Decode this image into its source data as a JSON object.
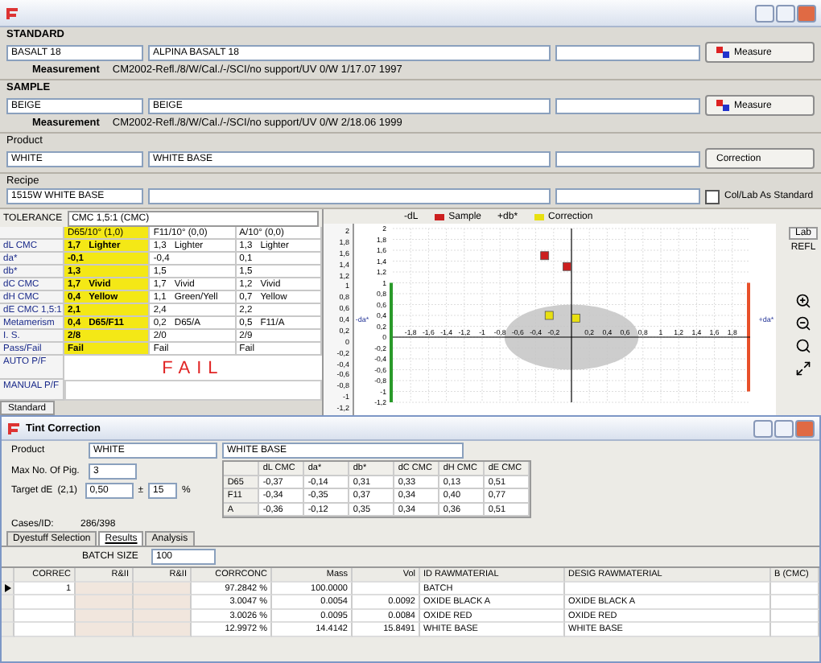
{
  "standard": {
    "label": "STANDARD",
    "code": "BASALT 18",
    "name": "ALPINA BASALT 18",
    "measure_button": "Measure",
    "measurement_label": "Measurement",
    "measurement": "CM2002-Refl./8/W/Cal./-/SCI/no support/UV 0/W 1/17.07 1997"
  },
  "sample": {
    "label": "SAMPLE",
    "code": "BEIGE",
    "name": "BEIGE",
    "measure_button": "Measure",
    "measurement_label": "Measurement",
    "measurement": "CM2002-Refl./8/W/Cal./-/SCI/no support/UV 0/W 2/18.06 1999"
  },
  "product": {
    "label": "Product",
    "code": "WHITE",
    "name": "WHITE BASE",
    "button": "Correction"
  },
  "recipe": {
    "label": "Recipe",
    "code": "1515W WHITE BASE",
    "checkbox": {
      "label": "Col/Lab As Standard",
      "checked": false
    }
  },
  "tolerance": {
    "label": "TOLERANCE",
    "value": "CMC 1,5:1 (CMC)"
  },
  "results_table": {
    "columns": [
      {
        "label": "D65/10° (1,0)",
        "highlighted": true
      },
      {
        "label": "F11/10° (0,0)",
        "highlighted": false
      },
      {
        "label": "A/10° (0,0)",
        "highlighted": false
      }
    ],
    "rows": [
      {
        "label": "dL CMC",
        "cells": [
          {
            "value": "1,7",
            "note": "Lighter"
          },
          {
            "value": "1,3",
            "note": "Lighter"
          },
          {
            "value": "1,3",
            "note": "Lighter"
          }
        ]
      },
      {
        "label": "da*",
        "cells": [
          {
            "value": "-0,1"
          },
          {
            "value": "-0,4"
          },
          {
            "value": "0,1"
          }
        ]
      },
      {
        "label": "db*",
        "cells": [
          {
            "value": "1,3"
          },
          {
            "value": "1,5"
          },
          {
            "value": "1,5"
          }
        ]
      },
      {
        "label": "dC CMC",
        "cells": [
          {
            "value": "1,7",
            "note": "Vivid"
          },
          {
            "value": "1,7",
            "note": "Vivid"
          },
          {
            "value": "1,2",
            "note": "Vivid"
          }
        ]
      },
      {
        "label": "dH CMC",
        "cells": [
          {
            "value": "0,4",
            "note": "Yellow"
          },
          {
            "value": "1,1",
            "note": "Green/Yell"
          },
          {
            "value": "0,7",
            "note": "Yellow"
          }
        ]
      },
      {
        "label": "dE CMC 1,5:1",
        "cells": [
          {
            "value": "2,1"
          },
          {
            "value": "2,4"
          },
          {
            "value": "2,2"
          }
        ]
      },
      {
        "label": "Metamerism",
        "cells": [
          {
            "value": "0,4",
            "note": "D65/F11"
          },
          {
            "value": "0,2",
            "note": "D65/A"
          },
          {
            "value": "0,5",
            "note": "F11/A"
          }
        ]
      },
      {
        "label": "I. S.",
        "cells": [
          {
            "value": "2/8"
          },
          {
            "value": "2/0"
          },
          {
            "value": "2/9"
          }
        ]
      },
      {
        "label": "Pass/Fail",
        "cells": [
          {
            "value": "Fail"
          },
          {
            "value": "Fail"
          },
          {
            "value": "Fail"
          }
        ]
      }
    ],
    "auto_label": "AUTO P/F",
    "verdict": "FAIL",
    "manual_label": "MANUAL P/F",
    "tab": "Standard"
  },
  "chart": {
    "top_label": "+db*",
    "left_label": "-da*",
    "right_label": "+da*",
    "l_label": "-dL",
    "l_ticks": [
      "2",
      "1,8",
      "1,6",
      "1,4",
      "1,2",
      "1",
      "0,8",
      "0,6",
      "0,4",
      "0,2",
      "0",
      "-0,2",
      "-0,4",
      "-0,6",
      "-0,8",
      "-1",
      "-1,2"
    ],
    "side_button": "Lab",
    "side_label": "REFL",
    "chart_data": {
      "type": "scatter",
      "grid": true,
      "x": [
        -0.3,
        -0.05,
        -0.25,
        0.05
      ],
      "xlim": [
        -2,
        2
      ],
      "ylim": [
        -1.2,
        2
      ],
      "xticks": [
        {
          "value": -1.8,
          "label": "-1,8"
        },
        {
          "value": -1.6,
          "label": "-1,6"
        },
        {
          "value": -1.4,
          "label": "-1,4"
        },
        {
          "value": -1.2,
          "label": "-1,2"
        },
        {
          "value": -1,
          "label": "-1"
        },
        {
          "value": -0.8,
          "label": "-0,8"
        },
        {
          "value": -0.6,
          "label": "-0,6"
        },
        {
          "value": -0.4,
          "label": "-0,4"
        },
        {
          "value": -0.2,
          "label": "-0,2"
        },
        {
          "value": 0.2,
          "label": "0,2"
        },
        {
          "value": 0.4,
          "label": "0,4"
        },
        {
          "value": 0.6,
          "label": "0,6"
        },
        {
          "value": 0.8,
          "label": "0,8"
        },
        {
          "value": 1,
          "label": "1"
        },
        {
          "value": 1.2,
          "label": "1,2"
        },
        {
          "value": 1.4,
          "label": "1,4"
        },
        {
          "value": 1.6,
          "label": "1,6"
        },
        {
          "value": 1.8,
          "label": "1,8"
        }
      ],
      "yticks": [
        {
          "value": 2,
          "label": "2"
        },
        {
          "value": 1.8,
          "label": "1,8"
        },
        {
          "value": 1.6,
          "label": "1,6"
        },
        {
          "value": 1.4,
          "label": "1,4"
        },
        {
          "value": 1.2,
          "label": "1,2"
        },
        {
          "value": 1,
          "label": "1"
        },
        {
          "value": 0.8,
          "label": "0,8"
        },
        {
          "value": 0.6,
          "label": "0,6"
        },
        {
          "value": 0.4,
          "label": "0,4"
        },
        {
          "value": 0.2,
          "label": "0,2"
        },
        {
          "value": 0,
          "label": "0"
        },
        {
          "value": -0.2,
          "label": "-0,2"
        },
        {
          "value": -0.4,
          "label": "-0,4"
        },
        {
          "value": -0.6,
          "label": "-0,6"
        },
        {
          "value": -0.8,
          "label": "-0,8"
        },
        {
          "value": -1,
          "label": "-1"
        },
        {
          "value": -1.2,
          "label": "-1,2"
        }
      ],
      "series": [
        {
          "name": "Sample",
          "color": "#cc1f1f",
          "values": [
            1.5,
            1.3,
            null,
            null
          ]
        },
        {
          "name": "Correction",
          "color": "#e8e010",
          "values": [
            null,
            null,
            0.4,
            0.35
          ]
        }
      ]
    }
  },
  "tint_window": {
    "title": "Tint Correction",
    "product_label": "Product",
    "product_code": "WHITE",
    "product_name": "WHITE BASE",
    "max_label": "Max No. Of Pig.",
    "max_value": "3",
    "target_label": "Target dE",
    "target_hint": "(2,1)",
    "target_value": "0,50",
    "plusminus": "±",
    "percent_value": "15",
    "percent": "%",
    "delta_table": {
      "columns": [
        "dL CMC",
        "da*",
        "db*",
        "dC CMC",
        "dH CMC",
        "dE CMC"
      ],
      "rows": [
        {
          "label": "D65",
          "values": [
            "-0,37",
            "-0,14",
            "0,31",
            "0,33",
            "0,13",
            "0,51"
          ]
        },
        {
          "label": "F11",
          "values": [
            "-0,34",
            "-0,35",
            "0,37",
            "0,34",
            "0,40",
            "0,77"
          ]
        },
        {
          "label": "A",
          "values": [
            "-0,36",
            "-0,12",
            "0,35",
            "0,34",
            "0,36",
            "0,51"
          ]
        }
      ]
    },
    "cases_label": "Cases/ID:",
    "cases_value": "286/398",
    "tabs": [
      {
        "label": "Dyestuff Selection",
        "selected": false
      },
      {
        "label": "Results",
        "selected": true
      },
      {
        "label": "Analysis",
        "selected": false
      }
    ],
    "batch_label": "BATCH SIZE",
    "batch_value": "100",
    "grid": {
      "columns": [
        "CORREC",
        "R&II",
        "R&II",
        "CORRCONC",
        "Mass",
        "Vol",
        "ID RAWMATERIAL",
        "DESIG RAWMATERIAL",
        "B (CMC)"
      ],
      "rows": [
        {
          "selected": true,
          "correc": "1",
          "corrconc": "97.2842 %",
          "mass": "100.0000",
          "id": "BATCH"
        },
        {
          "selected": false,
          "corrconc": "3.0047 %",
          "mass": "0.0054",
          "vol": "0.0092",
          "id": "OXIDE BLACK A",
          "desig": "OXIDE BLACK A"
        },
        {
          "selected": false,
          "corrconc": "3.0026 %",
          "mass": "0.0095",
          "vol": "0.0084",
          "id": "OXIDE RED",
          "desig": "OXIDE RED"
        },
        {
          "selected": false,
          "corrconc": "12.9972 %",
          "mass": "14.4142",
          "vol": "15.8491",
          "id": "WHITE BASE",
          "desig": "WHITE BASE"
        }
      ]
    }
  }
}
